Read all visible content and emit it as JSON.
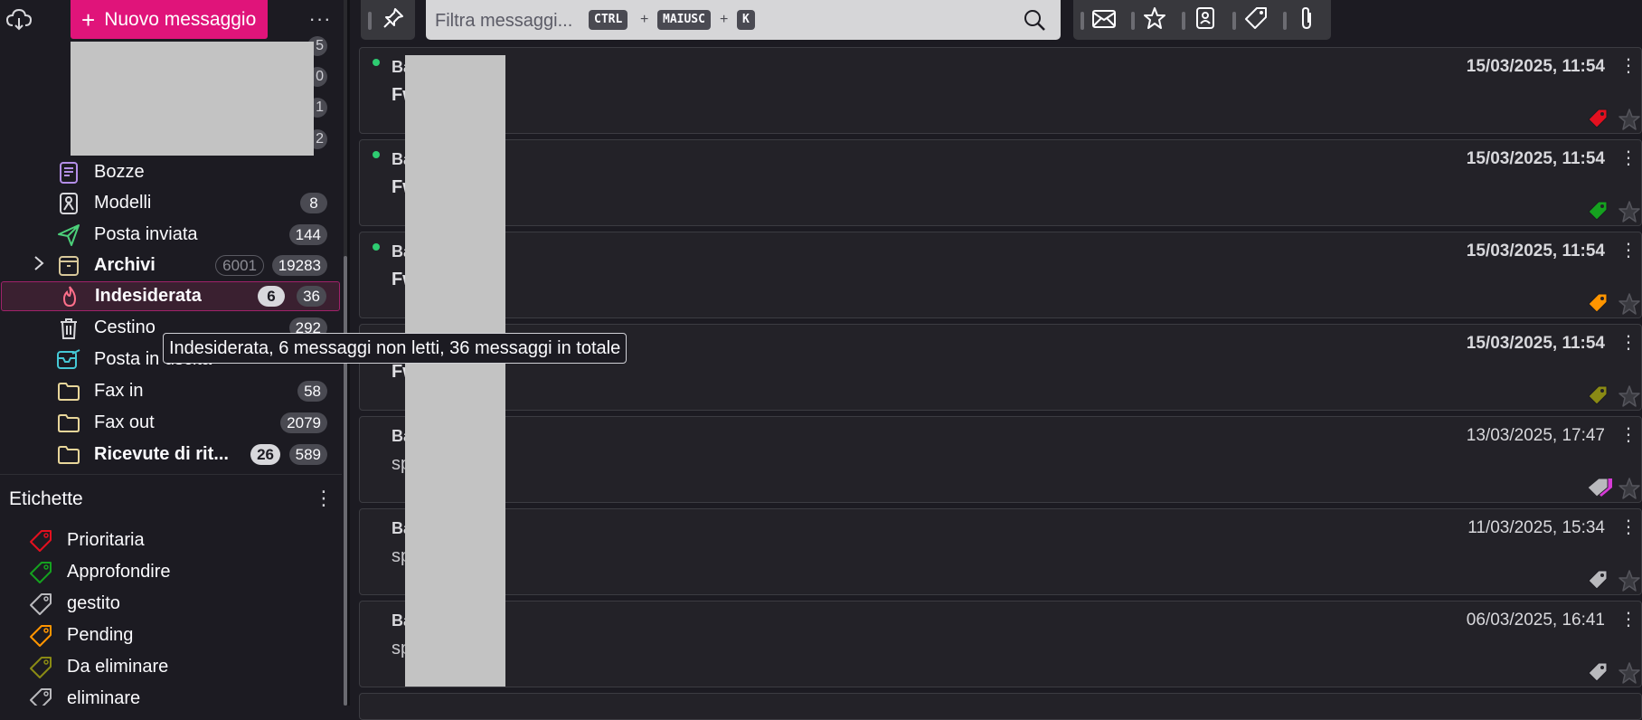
{
  "sidebar": {
    "new_message_label": "Nuovo messaggio",
    "more_label": "···",
    "partial_counts": [
      "5",
      "0",
      "1",
      "2"
    ],
    "folders": [
      {
        "name": "Bozze",
        "icon": "drafts-icon",
        "count": "",
        "unread": "",
        "bold": false
      },
      {
        "name": "Modelli",
        "icon": "templates-icon",
        "count": "8",
        "unread": "",
        "bold": false
      },
      {
        "name": "Posta inviata",
        "icon": "sent-icon",
        "count": "144",
        "unread": "",
        "bold": false
      },
      {
        "name": "Archivi",
        "icon": "archive-icon",
        "count": "19283",
        "unread": "6001",
        "bold": true
      },
      {
        "name": "Indesiderata",
        "icon": "junk-icon",
        "count": "36",
        "unread": "6",
        "bold": true
      },
      {
        "name": "Cestino",
        "icon": "trash-icon",
        "count": "292",
        "unread": "",
        "bold": false
      },
      {
        "name": "Posta in uscita",
        "icon": "outbox-icon",
        "count": "",
        "unread": "",
        "bold": false
      },
      {
        "name": "Fax in",
        "icon": "folder-icon",
        "count": "58",
        "unread": "",
        "bold": false
      },
      {
        "name": "Fax out",
        "icon": "folder-icon",
        "count": "2079",
        "unread": "",
        "bold": false
      },
      {
        "name": "Ricevute di rit...",
        "icon": "folder-icon",
        "count": "589",
        "unread": "26",
        "bold": true
      }
    ],
    "tags_title": "Etichette",
    "tags": [
      {
        "name": "Prioritaria",
        "color": "#e3101f"
      },
      {
        "name": "Approfondire",
        "color": "#15a11f"
      },
      {
        "name": "gestito",
        "color": "#b9b9bd"
      },
      {
        "name": "Pending",
        "color": "#ff9500"
      },
      {
        "name": "Da eliminare",
        "color": "#8a8a14"
      },
      {
        "name": "eliminare",
        "color": "#b9b9bd"
      }
    ]
  },
  "tooltip": "Indesiderata, 6 messaggi non letti, 36 messaggi in totale",
  "toolbar": {
    "search_placeholder": "Filtra messaggi...",
    "shortcut_keys": [
      "CTRL",
      "MAIUSC",
      "K"
    ],
    "shortcut_sep": "+"
  },
  "messages": [
    {
      "sender": "Ba",
      "subject": "Fw",
      "date": "15/03/2025, 11:54",
      "unread": true,
      "new": true,
      "tag_color": "#e3101f"
    },
    {
      "sender": "Ba",
      "subject": "Fw",
      "date": "15/03/2025, 11:54",
      "unread": true,
      "new": true,
      "tag_color": "#15a11f"
    },
    {
      "sender": "Ba",
      "subject": "Fw",
      "date": "15/03/2025, 11:54",
      "unread": true,
      "new": true,
      "tag_color": "#ff9500"
    },
    {
      "sender": "",
      "subject": "Fw",
      "date": "15/03/2025, 11:54",
      "unread": true,
      "new": false,
      "tag_color": "#8a8a14"
    },
    {
      "sender": "Ba",
      "subject": "sp",
      "date": "13/03/2025, 17:47",
      "unread": false,
      "new": false,
      "tag_color": "#b9b9bd",
      "tag_color2": "#d63bd6"
    },
    {
      "sender": "Ba",
      "subject": "sp",
      "date": "11/03/2025, 15:34",
      "unread": false,
      "new": false,
      "tag_color": "#b9b9bd"
    },
    {
      "sender": "Ba",
      "subject": "sp",
      "date": "06/03/2025, 16:41",
      "unread": false,
      "new": false,
      "tag_color": "#b9b9bd"
    }
  ]
}
